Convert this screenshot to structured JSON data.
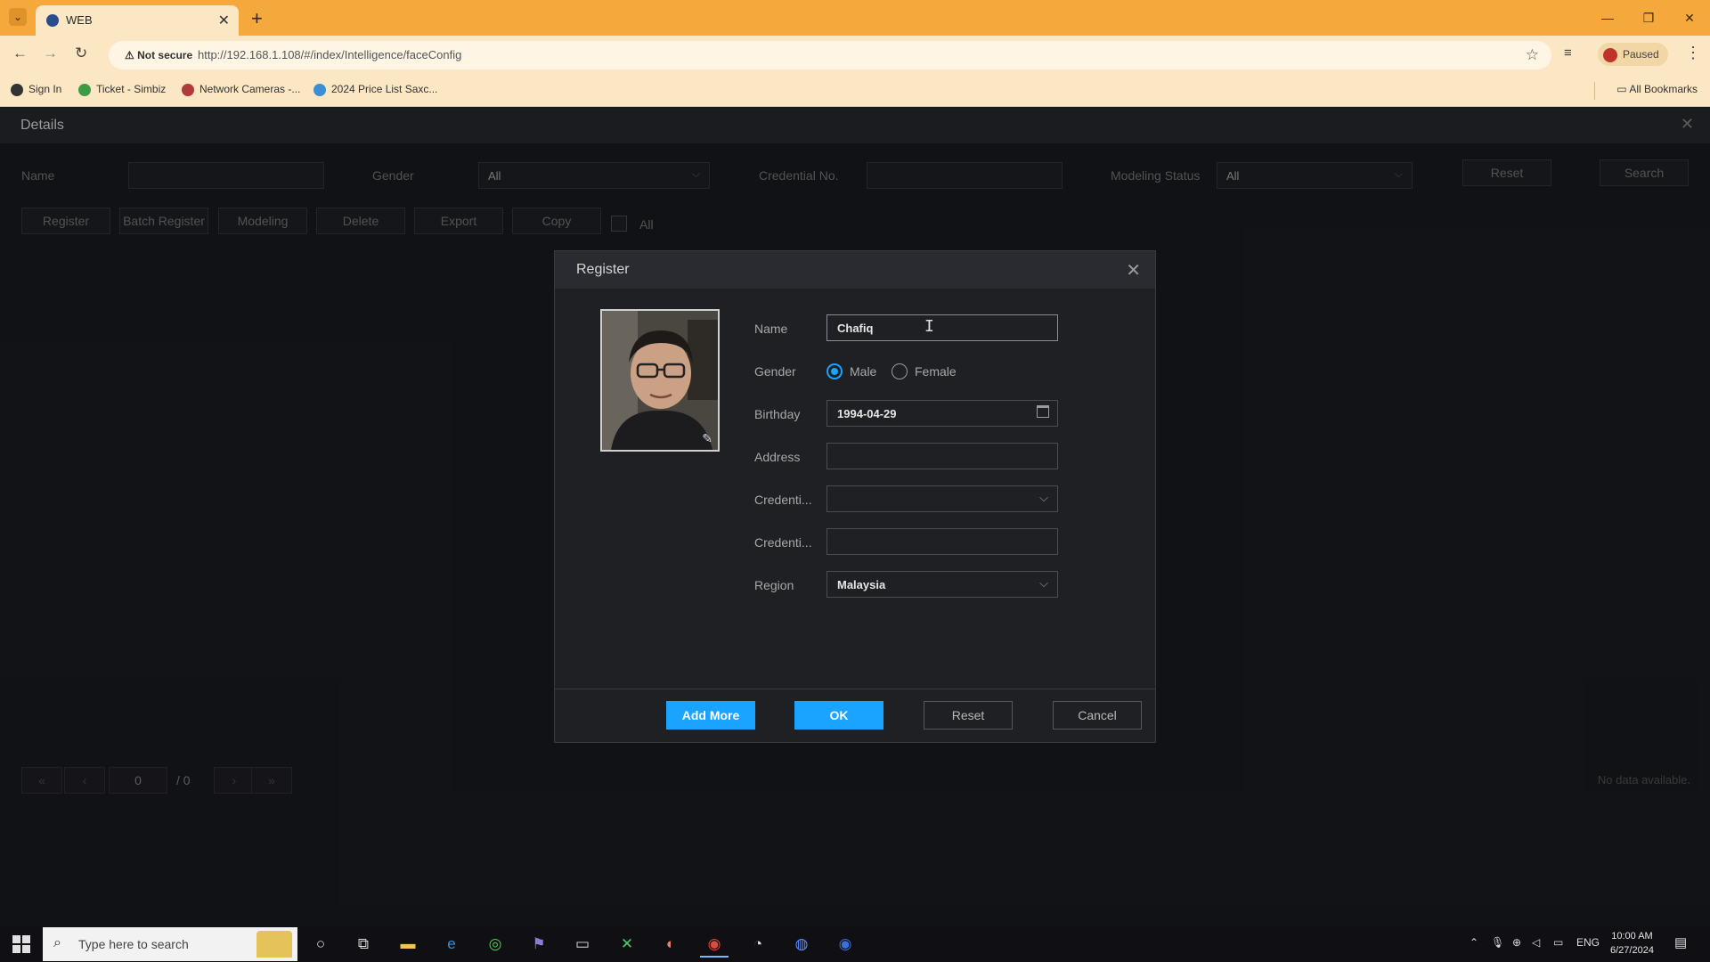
{
  "browser": {
    "tab_title": "WEB",
    "not_secure": "Not secure",
    "url": "http://192.168.1.108/#/index/Intelligence/faceConfig",
    "paused": "Paused",
    "bookmarks": [
      {
        "label": "Sign In",
        "color": "#333333"
      },
      {
        "label": "Ticket - Simbiz",
        "color": "#3e9b45"
      },
      {
        "label": "Network Cameras -...",
        "color": "#b23a3a"
      },
      {
        "label": "2024 Price List Saxc...",
        "color": "#3a8fd6"
      }
    ],
    "all_bookmarks": "All Bookmarks"
  },
  "page": {
    "title": "Details",
    "filters": {
      "name_label": "Name",
      "gender_label": "Gender",
      "gender_value": "All",
      "credential_label": "Credential No.",
      "modeling_label": "Modeling Status",
      "modeling_value": "All",
      "reset": "Reset",
      "search": "Search"
    },
    "toolbar": {
      "register": "Register",
      "batch_register": "Batch Register",
      "modeling": "Modeling",
      "delete": "Delete",
      "export": "Export",
      "copy": "Copy",
      "all": "All"
    },
    "pager": {
      "current": "0",
      "total": "/ 0",
      "first": "«",
      "prev": "‹",
      "next": "›",
      "last": "»"
    },
    "no_data": "No data available."
  },
  "modal": {
    "title": "Register",
    "fields": {
      "name_label": "Name",
      "name_value": "Chafiq",
      "gender_label": "Gender",
      "gender_male": "Male",
      "gender_female": "Female",
      "birthday_label": "Birthday",
      "birthday_value": "1994-04-29",
      "address_label": "Address",
      "address_value": "",
      "credential_type_label": "Credenti...",
      "credential_no_label": "Credenti...",
      "region_label": "Region",
      "region_value": "Malaysia"
    },
    "buttons": {
      "add_more": "Add More",
      "ok": "OK",
      "reset": "Reset",
      "cancel": "Cancel"
    }
  },
  "taskbar": {
    "search_placeholder": "Type here to search",
    "lang": "ENG",
    "time": "10:00 AM",
    "date": "6/27/2024"
  },
  "colors": {
    "accent": "#1aa3ff",
    "browser_frame": "#f5a83c"
  }
}
